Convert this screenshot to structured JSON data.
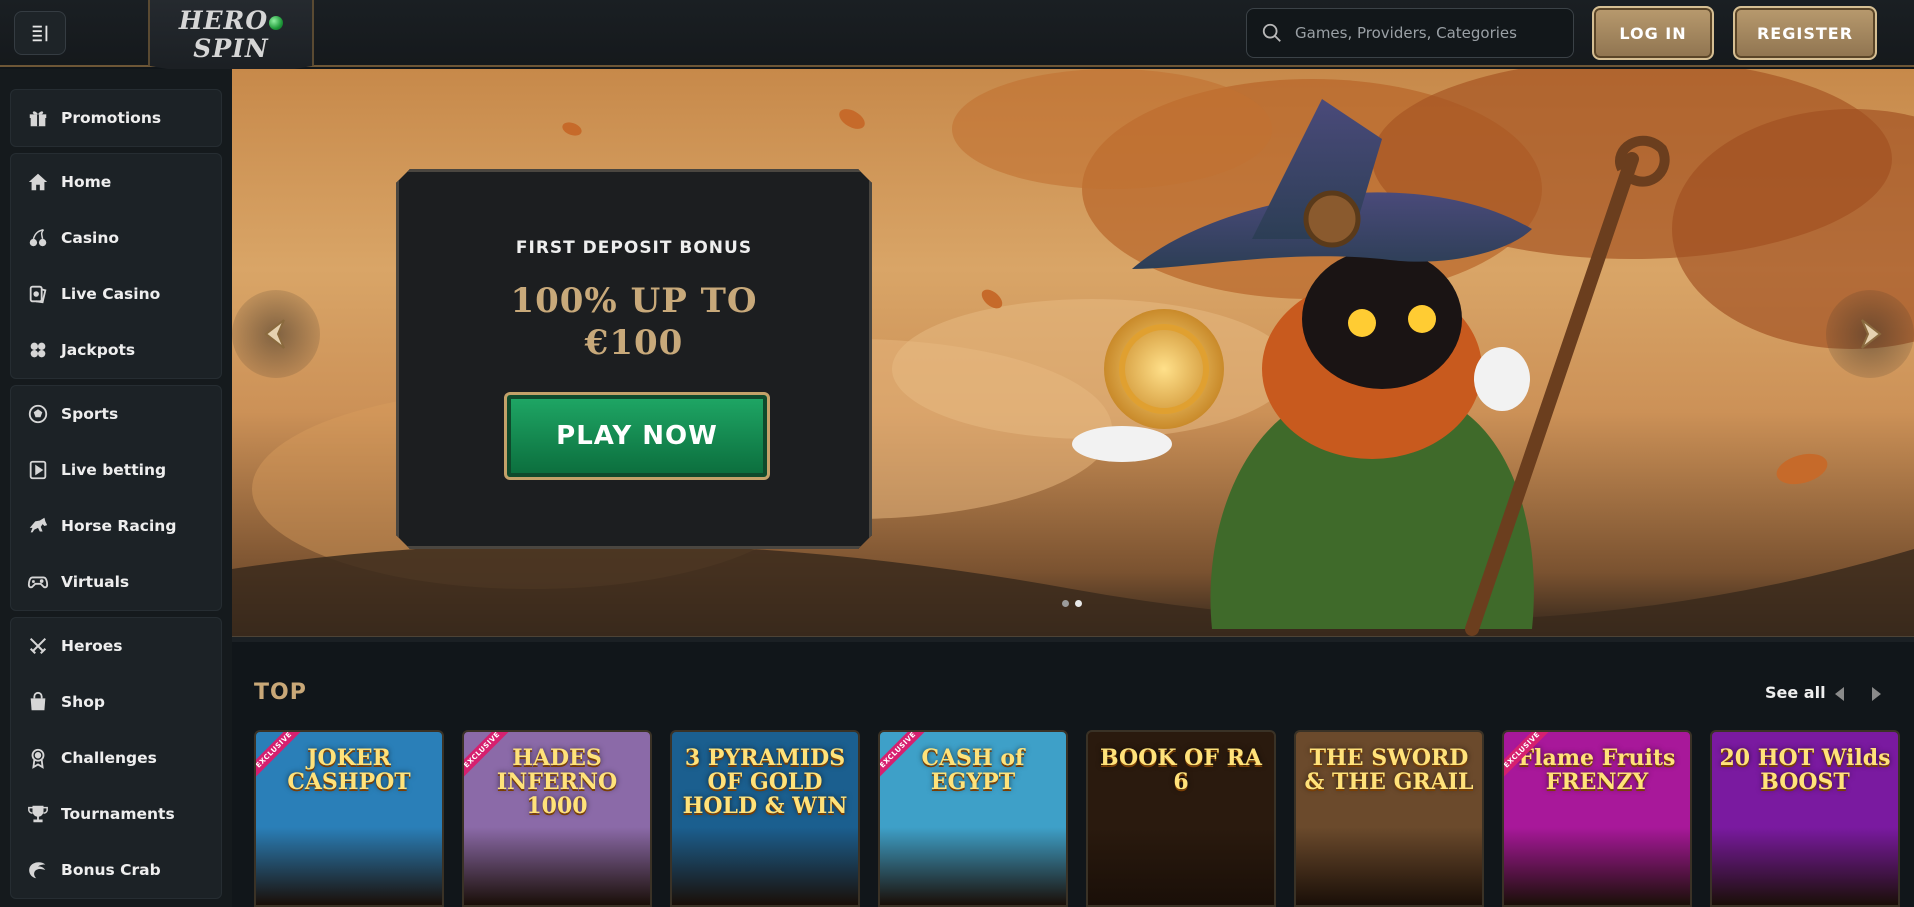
{
  "header": {
    "logo_line1": "HERO",
    "logo_line2": "SPIN",
    "search_placeholder": "Games, Providers, Categories",
    "login_label": "LOG IN",
    "register_label": "REGISTER"
  },
  "sidebar": {
    "groups": [
      [
        {
          "label": "Promotions",
          "icon": "gift-icon"
        }
      ],
      [
        {
          "label": "Home",
          "icon": "home-icon"
        },
        {
          "label": "Casino",
          "icon": "cherry-icon"
        },
        {
          "label": "Live Casino",
          "icon": "cards-icon"
        },
        {
          "label": "Jackpots",
          "icon": "clover-icon"
        }
      ],
      [
        {
          "label": "Sports",
          "icon": "soccer-ball-icon"
        },
        {
          "label": "Live betting",
          "icon": "play-square-icon"
        },
        {
          "label": "Horse Racing",
          "icon": "horse-icon"
        },
        {
          "label": "Virtuals",
          "icon": "gamepad-icon"
        }
      ],
      [
        {
          "label": "Heroes",
          "icon": "swords-icon"
        },
        {
          "label": "Shop",
          "icon": "shopping-bag-icon"
        },
        {
          "label": "Challenges",
          "icon": "medal-icon"
        },
        {
          "label": "Tournaments",
          "icon": "trophy-icon"
        },
        {
          "label": "Bonus Crab",
          "icon": "crab-claw-icon"
        }
      ]
    ]
  },
  "banner": {
    "subtitle": "FIRST DEPOSIT BONUS",
    "title_line1": "100% UP TO",
    "title_line2": "€100",
    "cta_label": "PLAY NOW",
    "slides": 2,
    "active_slide": 2
  },
  "top_section": {
    "title": "TOP",
    "see_all_label": "See all",
    "games": [
      {
        "name": "JOKER CASHPOT",
        "badge": "EXCLUSIVE",
        "bg": "#2a7fb8"
      },
      {
        "name": "HADES INFERNO 1000",
        "badge": "EXCLUSIVE",
        "bg": "#8b6aa8"
      },
      {
        "name": "3 PYRAMIDS OF GOLD HOLD & WIN",
        "badge": "",
        "bg": "#1b5f8f"
      },
      {
        "name": "CASH of EGYPT",
        "badge": "EXCLUSIVE",
        "bg": "#3ea0c8"
      },
      {
        "name": "BOOK OF RA 6",
        "badge": "",
        "bg": "#2a1a0e"
      },
      {
        "name": "THE SWORD & THE GRAIL",
        "badge": "",
        "bg": "#6b4a2c"
      },
      {
        "name": "Flame Fruits FRENZY",
        "badge": "EXCLUSIVE",
        "bg": "#a8189a"
      },
      {
        "name": "20 HOT Wilds BOOST",
        "badge": "",
        "bg": "#7a1aa0"
      }
    ]
  },
  "colors": {
    "accent_gold": "#c9a878",
    "cta_green": "#1fa866",
    "header_bg": "#1a1f23",
    "sidebar_bg": "#1c2226"
  }
}
